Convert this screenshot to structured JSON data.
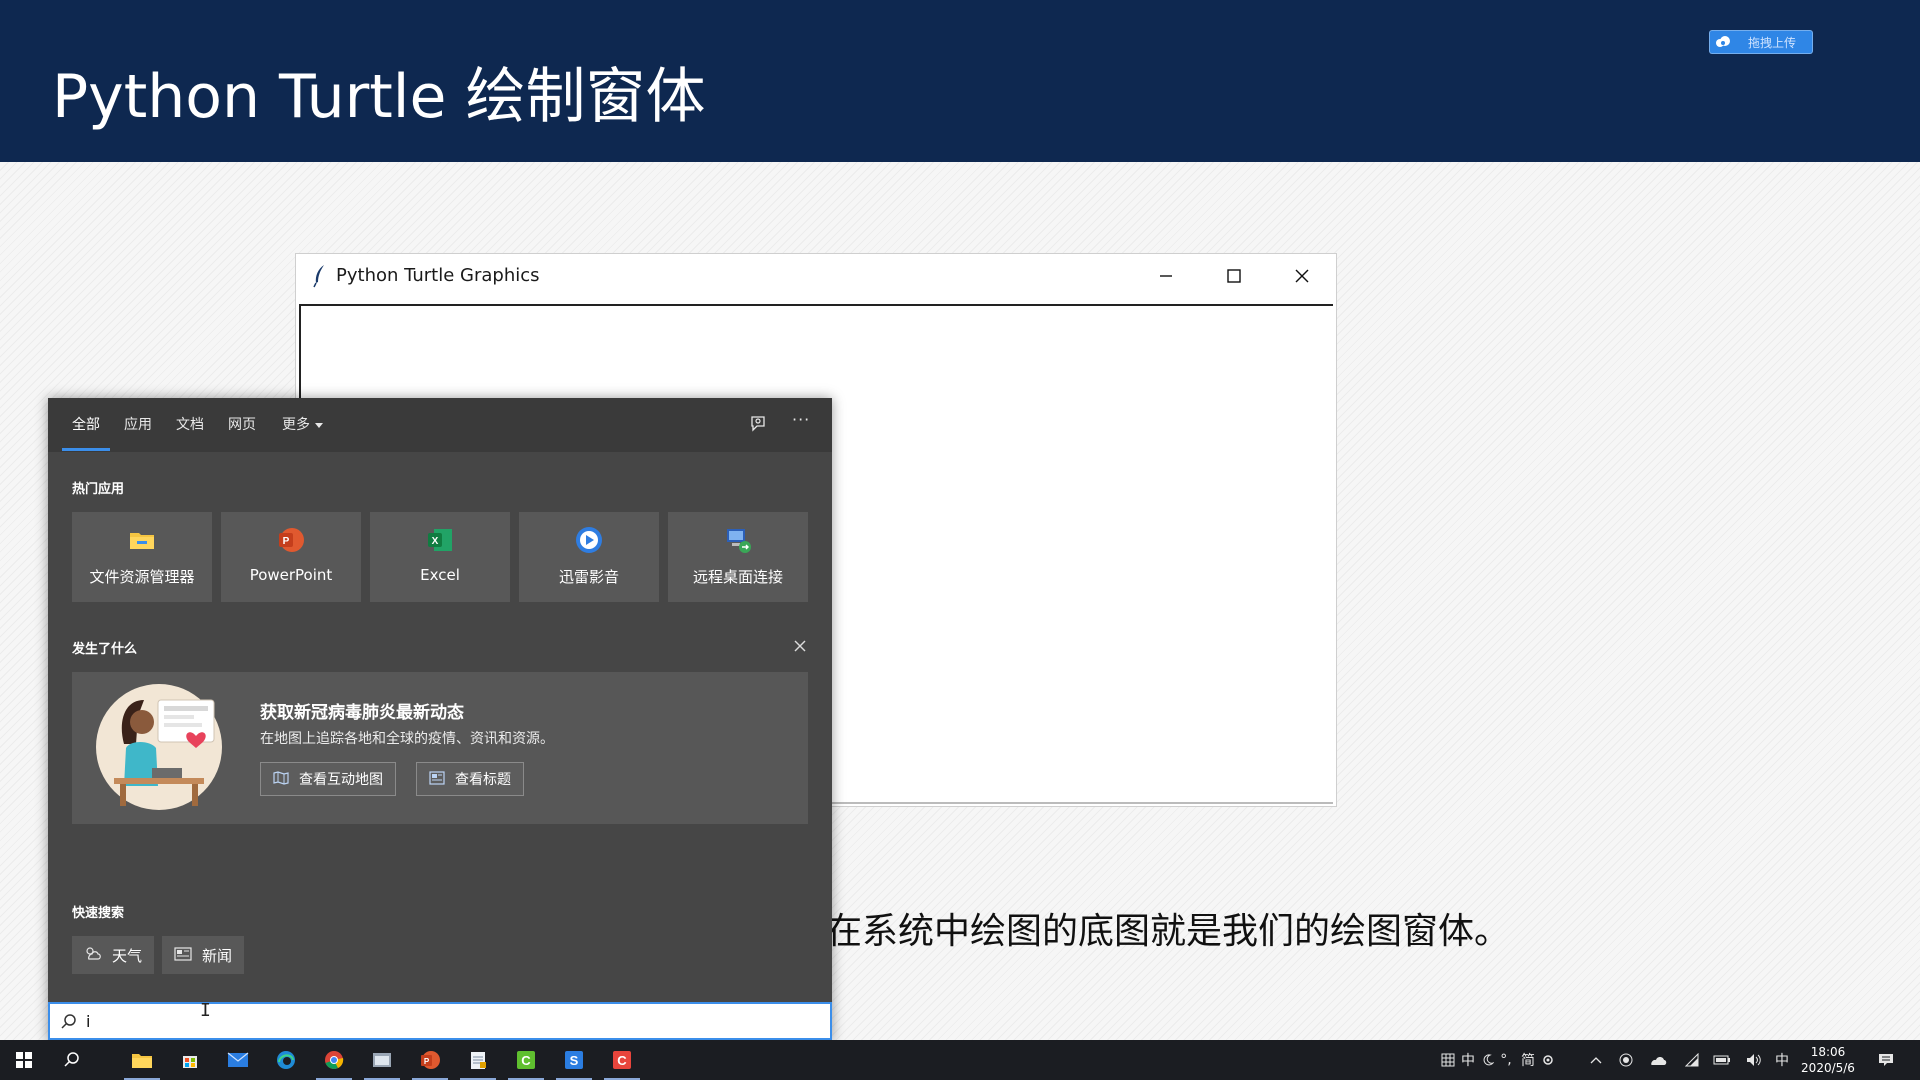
{
  "slide": {
    "title": "Python Turtle 绘制窗体",
    "upload_badge": "拖拽上传",
    "body_text": "在系统中绘图的底图就是我们的绘图窗体。"
  },
  "turtle_window": {
    "title": "Python Turtle Graphics"
  },
  "search_panel": {
    "tabs": [
      {
        "label": "全部",
        "active": true
      },
      {
        "label": "应用"
      },
      {
        "label": "文档"
      },
      {
        "label": "网页"
      },
      {
        "label": "更多"
      }
    ],
    "ellipsis": "···",
    "hot_apps_title": "热门应用",
    "hot_apps": [
      {
        "label": "文件资源管理器",
        "icon": "folder-icon"
      },
      {
        "label": "PowerPoint",
        "icon": "powerpoint-icon"
      },
      {
        "label": "Excel",
        "icon": "excel-icon"
      },
      {
        "label": "迅雷影音",
        "icon": "xunlei-player-icon"
      },
      {
        "label": "远程桌面连接",
        "icon": "remote-desktop-icon"
      }
    ],
    "whats_new_title": "发生了什么",
    "news_card": {
      "title": "获取新冠病毒肺炎最新动态",
      "description": "在地图上追踪各地和全球的疫情、资讯和资源。",
      "buttons": [
        {
          "label": "查看互动地图",
          "icon": "map-icon"
        },
        {
          "label": "查看标题",
          "icon": "news-icon"
        }
      ]
    },
    "quick_search_title": "快速搜索",
    "quick_search": [
      {
        "label": "天气",
        "icon": "weather-icon"
      },
      {
        "label": "新闻",
        "icon": "news-icon"
      }
    ],
    "search_value": "i",
    "search_placeholder": ""
  },
  "taskbar": {
    "apps": [
      "start",
      "search",
      "file-explorer",
      "store",
      "mail",
      "edge",
      "chrome",
      "app-window",
      "powerpoint",
      "notepad",
      "camtasia-green",
      "sublime",
      "camtasia-red"
    ],
    "tray": {
      "ime_chars": "中",
      "ime_mode": "简",
      "lang": "中",
      "time": "18:06",
      "date": "2020/5/6"
    }
  },
  "colors": {
    "header_bg": "#0e2850",
    "panel_bg": "#464646",
    "accent": "#3b8eea",
    "taskbar_bg": "#1b1d22"
  }
}
